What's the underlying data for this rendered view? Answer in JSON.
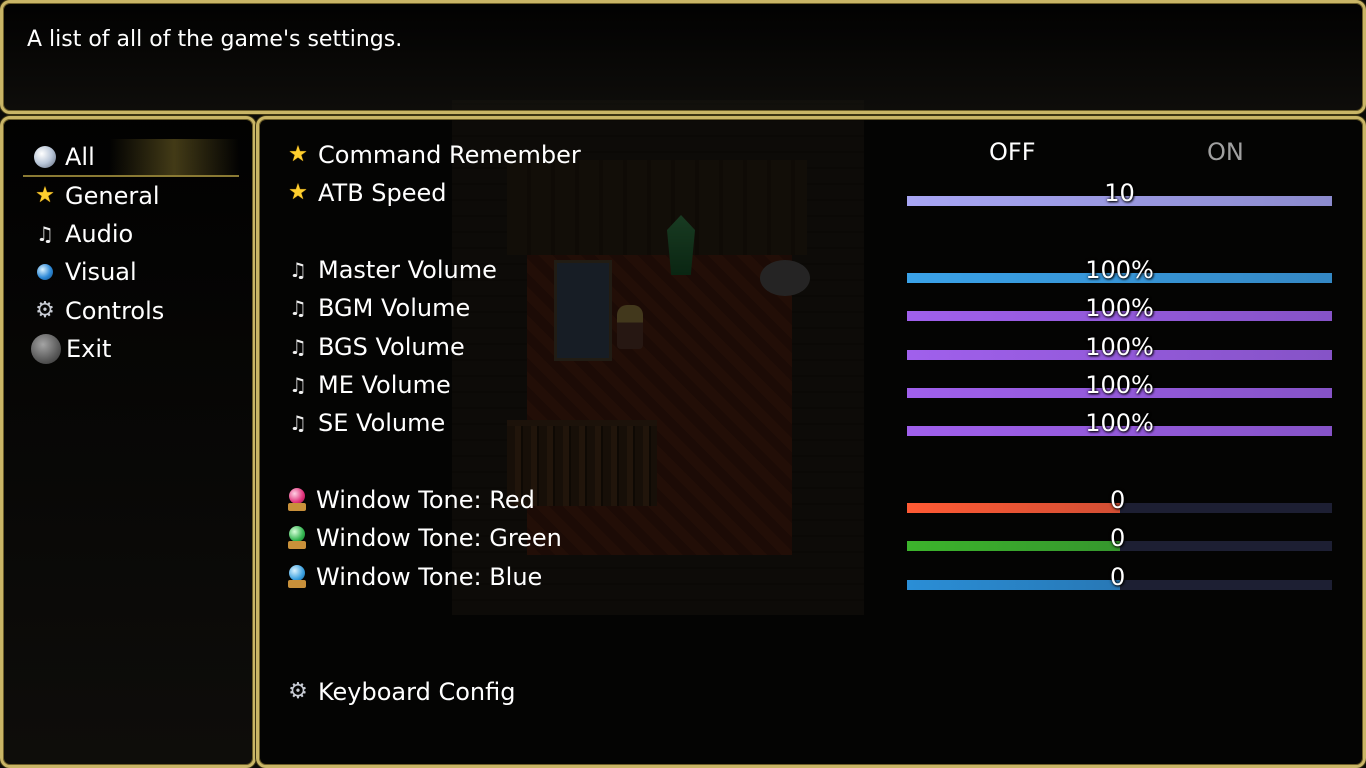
{
  "help": {
    "text": "A list of all of the game's settings."
  },
  "categories": [
    {
      "label": "All",
      "icon": "orb-icon"
    },
    {
      "label": "General",
      "icon": "star-icon"
    },
    {
      "label": "Audio",
      "icon": "music-note-icon"
    },
    {
      "label": "Visual",
      "icon": "globe-icon"
    },
    {
      "label": "Controls",
      "icon": "gear-icon"
    },
    {
      "label": "Exit",
      "icon": "dark-orb-icon"
    }
  ],
  "options": {
    "command_remember": {
      "label": "Command Remember",
      "off": "OFF",
      "on": "ON",
      "selected": "OFF"
    },
    "atb_speed": {
      "label": "ATB Speed",
      "value_text": "10",
      "fill": 1.0,
      "color": "#a8a6f4"
    },
    "master_volume": {
      "label": "Master Volume",
      "value_text": "100%",
      "fill": 1.0,
      "color": "#3aa2e8"
    },
    "bgm_volume": {
      "label": "BGM Volume",
      "value_text": "100%",
      "fill": 1.0,
      "color": "#a060ec"
    },
    "bgs_volume": {
      "label": "BGS Volume",
      "value_text": "100%",
      "fill": 1.0,
      "color": "#a060ec"
    },
    "me_volume": {
      "label": "ME Volume",
      "value_text": "100%",
      "fill": 1.0,
      "color": "#a060ec"
    },
    "se_volume": {
      "label": "SE Volume",
      "value_text": "100%",
      "fill": 1.0,
      "color": "#a060ec"
    },
    "tone_red": {
      "label": "Window Tone: Red",
      "value_text": "0",
      "fill": 0.5,
      "color": "#ff5a34"
    },
    "tone_green": {
      "label": "Window Tone: Green",
      "value_text": "0",
      "fill": 0.5,
      "color": "#3cb42c"
    },
    "tone_blue": {
      "label": "Window Tone: Blue",
      "value_text": "0",
      "fill": 0.5,
      "color": "#2a8ed6"
    },
    "keyboard_config": {
      "label": "Keyboard Config"
    }
  },
  "colors": {
    "window_border": "#c9b566",
    "off_active": "#ffffff",
    "on_inactive": "#a0a0a0"
  }
}
